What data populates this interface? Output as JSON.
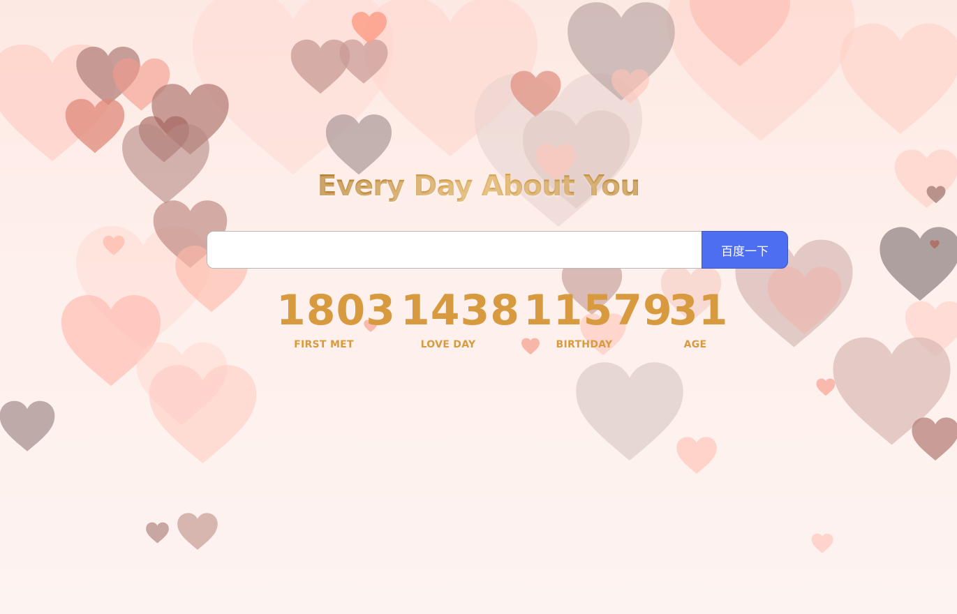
{
  "title": "Every Day About You",
  "search": {
    "value": "",
    "placeholder": "",
    "button_label": "百度一下"
  },
  "stats": [
    {
      "value": "1803",
      "label": "FIRST MET"
    },
    {
      "value": "1438",
      "label": "LOVE DAY"
    },
    {
      "value": "11579",
      "label": "BIRTHDAY"
    },
    {
      "value": "31",
      "label": "AGE"
    }
  ],
  "colors": {
    "accent": "#d89a3e",
    "button": "#4e6ef2",
    "background": "#fdeee9"
  },
  "decorations": {
    "icon": "heart-icon"
  }
}
